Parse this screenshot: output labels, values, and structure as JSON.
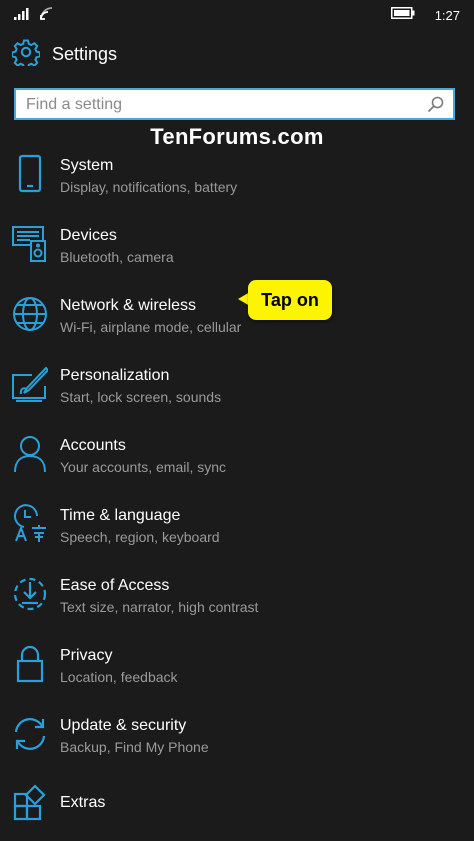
{
  "status_bar": {
    "time": "1:27",
    "icons": [
      "signal-icon",
      "wifi-icon",
      "battery-icon"
    ]
  },
  "header": {
    "title": "Settings",
    "icon": "gear-icon"
  },
  "search": {
    "placeholder": "Find a setting",
    "value": ""
  },
  "watermark": "TenForums.com",
  "items": [
    {
      "title": "System",
      "subtitle": "Display, notifications, battery",
      "icon": "phone-icon"
    },
    {
      "title": "Devices",
      "subtitle": "Bluetooth, camera",
      "icon": "devices-icon"
    },
    {
      "title": "Network & wireless",
      "subtitle": "Wi-Fi, airplane mode, cellular",
      "icon": "globe-icon"
    },
    {
      "title": "Personalization",
      "subtitle": "Start, lock screen, sounds",
      "icon": "paintbrush-icon"
    },
    {
      "title": "Accounts",
      "subtitle": "Your accounts, email, sync",
      "icon": "person-icon"
    },
    {
      "title": "Time & language",
      "subtitle": "Speech, region, keyboard",
      "icon": "time-language-icon"
    },
    {
      "title": "Ease of Access",
      "subtitle": "Text size, narrator, high contrast",
      "icon": "ease-of-access-icon"
    },
    {
      "title": "Privacy",
      "subtitle": "Location, feedback",
      "icon": "lock-icon"
    },
    {
      "title": "Update & security",
      "subtitle": "Backup, Find My Phone",
      "icon": "sync-icon"
    },
    {
      "title": "Extras",
      "subtitle": "",
      "icon": "extras-icon"
    }
  ],
  "callout": {
    "text": "Tap on"
  },
  "colors": {
    "accent": "#2a9fd8",
    "background": "#1b1b1b",
    "subtitle": "#9a9a9a",
    "callout": "#fdf400"
  }
}
